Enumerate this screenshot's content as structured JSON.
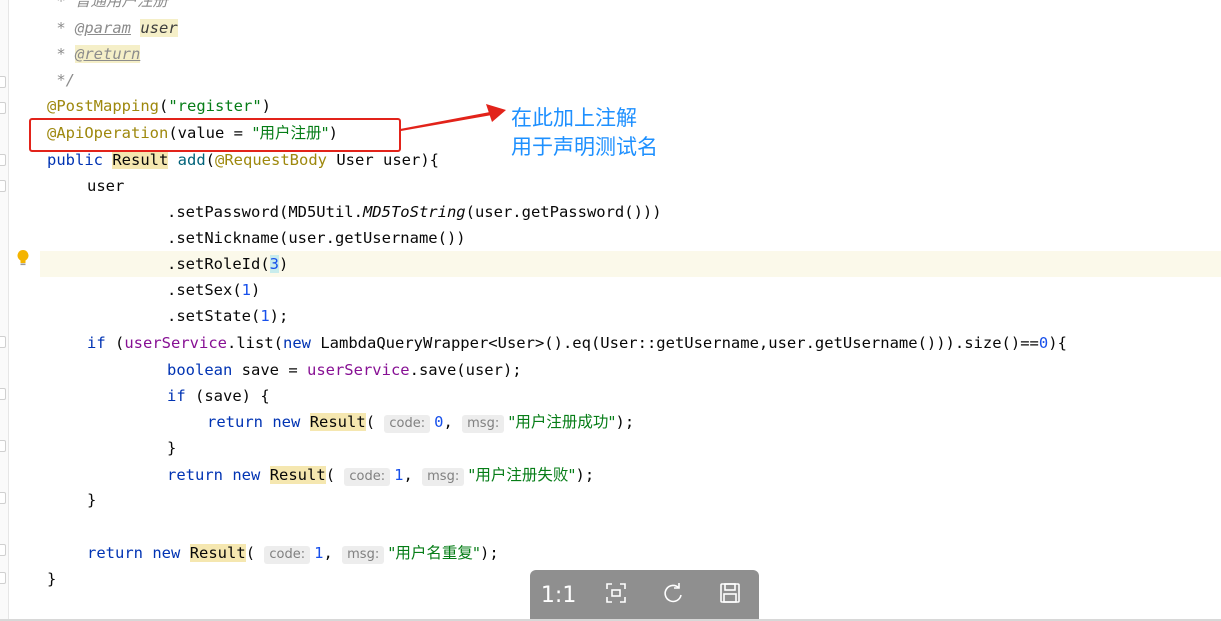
{
  "code": {
    "line_comment_title": " * 普通用户注册",
    "line_param": {
      "star": " * ",
      "tag": "@param",
      "name": "user"
    },
    "line_return": {
      "star": " * ",
      "tag": "@return"
    },
    "line_comment_end": " */",
    "post_mapping": {
      "ann": "@PostMapping",
      "open": "(",
      "str": "\"register\"",
      "close": ")"
    },
    "api_operation": {
      "ann": "@ApiOperation",
      "pre": "(value = ",
      "str": "\"用户注册\"",
      "close": ")"
    },
    "method_sig": {
      "public": "public ",
      "result": "Result",
      "sp": " ",
      "add": "add",
      "open": "(",
      "ann": "@RequestBody",
      "rest": " User user){"
    },
    "user": "user",
    "set_password": {
      "pre": ".setPassword(MD5Util.",
      "method": "MD5ToString",
      "post": "(user.getPassword()))"
    },
    "set_nickname": ".setNickname(user.getUsername())",
    "set_roleid": {
      "pre": ".setRoleId(",
      "num": "3",
      "post": ")"
    },
    "set_sex": {
      "pre": ".setSex(",
      "num": "1",
      "post": ")"
    },
    "set_state": {
      "pre": ".setState(",
      "num": "1",
      "post": ");"
    },
    "if_line": {
      "if": "if",
      "p1": " (",
      "svc": "userService",
      "p2": ".list(",
      "new": "new",
      "p3": " LambdaQueryWrapper<User>().eq(User::getUsername,user.getUsername())).size()==",
      "num": "0",
      "p4": "){"
    },
    "save_line": {
      "kw": "boolean",
      "p1": " save = ",
      "svc": "userService",
      "p2": ".save(user);"
    },
    "if_save": {
      "kw": "if",
      "rest": " (save) {"
    },
    "ret_success": {
      "ret": "return",
      "new": "new",
      "result": "Result",
      "open": "(",
      "hint_code": "code:",
      "num": "0",
      "comma": ",",
      "hint_msg": "msg:",
      "str": "\"用户注册成功\"",
      "close": ");"
    },
    "close_brace_1": "}",
    "ret_fail": {
      "ret": "return",
      "new": "new",
      "result": "Result",
      "open": "(",
      "hint_code": "code:",
      "num": "1",
      "comma": ",",
      "hint_msg": "msg:",
      "str": "\"用户注册失败\"",
      "close": ");"
    },
    "close_brace_2": "}",
    "ret_dup": {
      "ret": "return",
      "new": "new",
      "result": "Result",
      "open": "(",
      "hint_code": "code:",
      "num": "1",
      "comma": ",",
      "hint_msg": "msg:",
      "str": "\"用户名重复\"",
      "close": ");"
    },
    "close_brace_3": "}"
  },
  "annotation": {
    "line1": "在此加上注解",
    "line2": "用于声明测试名",
    "color": "#1e90ff",
    "box_color": "#e2231a"
  },
  "toolbar": {
    "actual_size_label": "1:1",
    "fit_icon": "fit-screen-icon",
    "rotate_icon": "rotate-icon",
    "save_icon": "save-icon"
  }
}
